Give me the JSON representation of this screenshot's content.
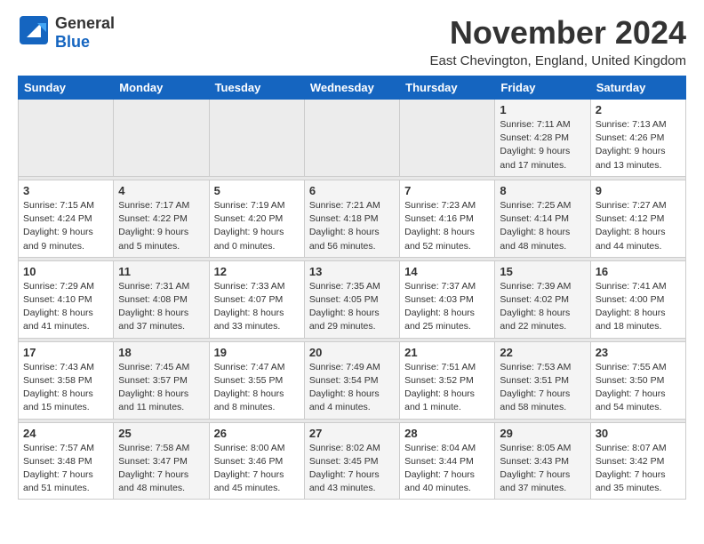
{
  "logo": {
    "text_general": "General",
    "text_blue": "Blue"
  },
  "title": "November 2024",
  "location": "East Chevington, England, United Kingdom",
  "days_of_week": [
    "Sunday",
    "Monday",
    "Tuesday",
    "Wednesday",
    "Thursday",
    "Friday",
    "Saturday"
  ],
  "weeks": [
    [
      {
        "day": "",
        "info": ""
      },
      {
        "day": "",
        "info": ""
      },
      {
        "day": "",
        "info": ""
      },
      {
        "day": "",
        "info": ""
      },
      {
        "day": "",
        "info": ""
      },
      {
        "day": "1",
        "info": "Sunrise: 7:11 AM\nSunset: 4:28 PM\nDaylight: 9 hours and 17 minutes."
      },
      {
        "day": "2",
        "info": "Sunrise: 7:13 AM\nSunset: 4:26 PM\nDaylight: 9 hours and 13 minutes."
      }
    ],
    [
      {
        "day": "3",
        "info": "Sunrise: 7:15 AM\nSunset: 4:24 PM\nDaylight: 9 hours and 9 minutes."
      },
      {
        "day": "4",
        "info": "Sunrise: 7:17 AM\nSunset: 4:22 PM\nDaylight: 9 hours and 5 minutes."
      },
      {
        "day": "5",
        "info": "Sunrise: 7:19 AM\nSunset: 4:20 PM\nDaylight: 9 hours and 0 minutes."
      },
      {
        "day": "6",
        "info": "Sunrise: 7:21 AM\nSunset: 4:18 PM\nDaylight: 8 hours and 56 minutes."
      },
      {
        "day": "7",
        "info": "Sunrise: 7:23 AM\nSunset: 4:16 PM\nDaylight: 8 hours and 52 minutes."
      },
      {
        "day": "8",
        "info": "Sunrise: 7:25 AM\nSunset: 4:14 PM\nDaylight: 8 hours and 48 minutes."
      },
      {
        "day": "9",
        "info": "Sunrise: 7:27 AM\nSunset: 4:12 PM\nDaylight: 8 hours and 44 minutes."
      }
    ],
    [
      {
        "day": "10",
        "info": "Sunrise: 7:29 AM\nSunset: 4:10 PM\nDaylight: 8 hours and 41 minutes."
      },
      {
        "day": "11",
        "info": "Sunrise: 7:31 AM\nSunset: 4:08 PM\nDaylight: 8 hours and 37 minutes."
      },
      {
        "day": "12",
        "info": "Sunrise: 7:33 AM\nSunset: 4:07 PM\nDaylight: 8 hours and 33 minutes."
      },
      {
        "day": "13",
        "info": "Sunrise: 7:35 AM\nSunset: 4:05 PM\nDaylight: 8 hours and 29 minutes."
      },
      {
        "day": "14",
        "info": "Sunrise: 7:37 AM\nSunset: 4:03 PM\nDaylight: 8 hours and 25 minutes."
      },
      {
        "day": "15",
        "info": "Sunrise: 7:39 AM\nSunset: 4:02 PM\nDaylight: 8 hours and 22 minutes."
      },
      {
        "day": "16",
        "info": "Sunrise: 7:41 AM\nSunset: 4:00 PM\nDaylight: 8 hours and 18 minutes."
      }
    ],
    [
      {
        "day": "17",
        "info": "Sunrise: 7:43 AM\nSunset: 3:58 PM\nDaylight: 8 hours and 15 minutes."
      },
      {
        "day": "18",
        "info": "Sunrise: 7:45 AM\nSunset: 3:57 PM\nDaylight: 8 hours and 11 minutes."
      },
      {
        "day": "19",
        "info": "Sunrise: 7:47 AM\nSunset: 3:55 PM\nDaylight: 8 hours and 8 minutes."
      },
      {
        "day": "20",
        "info": "Sunrise: 7:49 AM\nSunset: 3:54 PM\nDaylight: 8 hours and 4 minutes."
      },
      {
        "day": "21",
        "info": "Sunrise: 7:51 AM\nSunset: 3:52 PM\nDaylight: 8 hours and 1 minute."
      },
      {
        "day": "22",
        "info": "Sunrise: 7:53 AM\nSunset: 3:51 PM\nDaylight: 7 hours and 58 minutes."
      },
      {
        "day": "23",
        "info": "Sunrise: 7:55 AM\nSunset: 3:50 PM\nDaylight: 7 hours and 54 minutes."
      }
    ],
    [
      {
        "day": "24",
        "info": "Sunrise: 7:57 AM\nSunset: 3:48 PM\nDaylight: 7 hours and 51 minutes."
      },
      {
        "day": "25",
        "info": "Sunrise: 7:58 AM\nSunset: 3:47 PM\nDaylight: 7 hours and 48 minutes."
      },
      {
        "day": "26",
        "info": "Sunrise: 8:00 AM\nSunset: 3:46 PM\nDaylight: 7 hours and 45 minutes."
      },
      {
        "day": "27",
        "info": "Sunrise: 8:02 AM\nSunset: 3:45 PM\nDaylight: 7 hours and 43 minutes."
      },
      {
        "day": "28",
        "info": "Sunrise: 8:04 AM\nSunset: 3:44 PM\nDaylight: 7 hours and 40 minutes."
      },
      {
        "day": "29",
        "info": "Sunrise: 8:05 AM\nSunset: 3:43 PM\nDaylight: 7 hours and 37 minutes."
      },
      {
        "day": "30",
        "info": "Sunrise: 8:07 AM\nSunset: 3:42 PM\nDaylight: 7 hours and 35 minutes."
      }
    ]
  ]
}
